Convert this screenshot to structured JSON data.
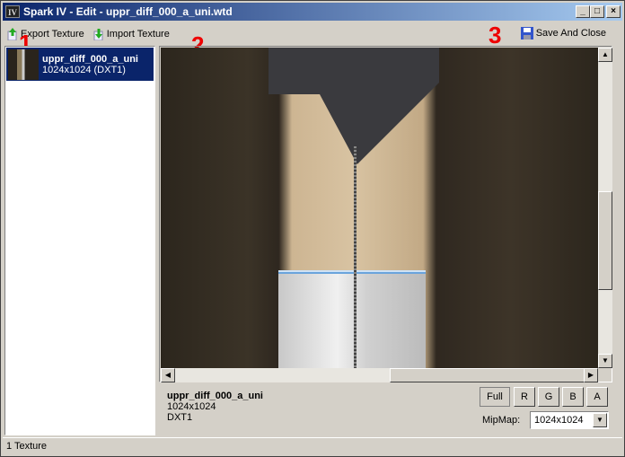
{
  "window": {
    "title": "Spark IV - Edit - uppr_diff_000_a_uni.wtd",
    "app_icon": "IV",
    "minimize": "_",
    "maximize": "□",
    "close": "×"
  },
  "toolbar": {
    "export_label": "Export Texture",
    "import_label": "Import Texture",
    "save_label": "Save And Close"
  },
  "annotations": {
    "one": "1",
    "two": "2",
    "three": "3"
  },
  "textures": [
    {
      "name": "uppr_diff_000_a_uni",
      "detail": "1024x1024 (DXT1)"
    }
  ],
  "info": {
    "name": "uppr_diff_000_a_uni",
    "size": "1024x1024",
    "format": "DXT1"
  },
  "buttons": {
    "full": "Full",
    "r": "R",
    "g": "G",
    "b": "B",
    "a": "A"
  },
  "mipmap": {
    "label": "MipMap:",
    "value": "1024x1024"
  },
  "status": "1 Texture"
}
